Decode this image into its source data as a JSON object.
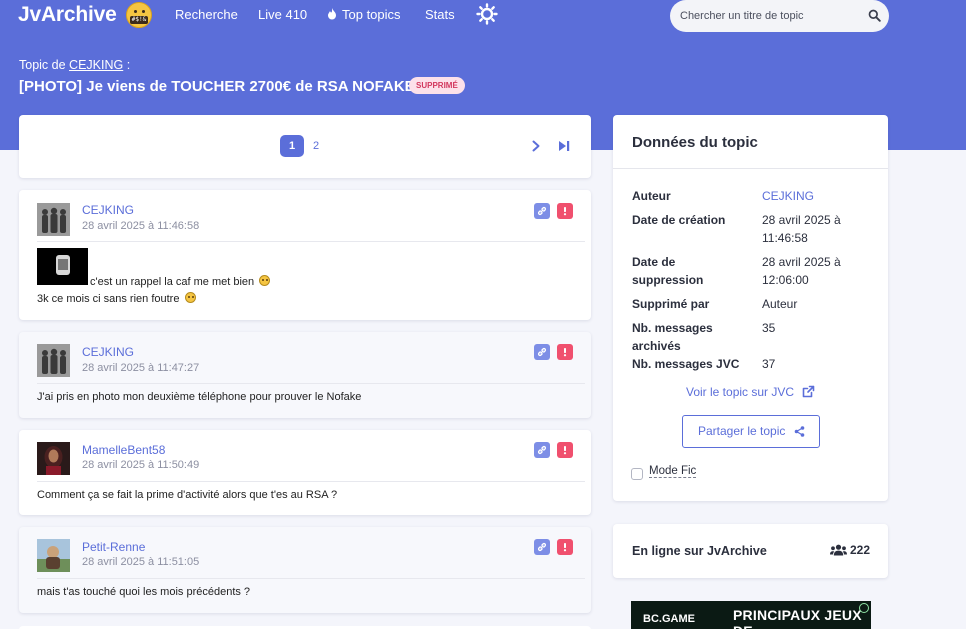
{
  "header": {
    "logo": "JvArchive",
    "logo_emoji_text": "#$!&",
    "nav": [
      "Recherche",
      "Live 410",
      "Top topics",
      "Stats"
    ],
    "search_placeholder": "Chercher un titre de topic"
  },
  "topic": {
    "of_label": "Topic de",
    "author": "CEJKING",
    "author_suffix": ":",
    "title": "[PHOTO] Je viens de TOUCHER 2700€ de RSA NOFAKE",
    "badge": "SUPPRIMÉ"
  },
  "pagination": {
    "pages": [
      "1",
      "2"
    ],
    "current": "1"
  },
  "posts": [
    {
      "author": "CEJKING",
      "date": "28 avril 2025 à 11:46:58",
      "lines": [
        "c'est un rappel la caf me met bien",
        "3k ce mois ci sans rien foutre"
      ]
    },
    {
      "author": "CEJKING",
      "date": "28 avril 2025 à 11:47:27",
      "lines": [
        "J'ai pris en photo mon deuxième téléphone pour prouver le Nofake"
      ]
    },
    {
      "author": "MamelleBent58",
      "date": "28 avril 2025 à 11:50:49",
      "lines": [
        "Comment ça se fait la prime d'activité alors que t'es au RSA ?"
      ]
    },
    {
      "author": "Petit-Renne",
      "date": "28 avril 2025 à 11:51:05",
      "lines": [
        "mais t'as touché quoi les mois précédents ?"
      ]
    }
  ],
  "sidebar": {
    "title": "Données du topic",
    "rows": [
      {
        "key": [
          "Auteur"
        ],
        "value": [
          "CEJKING"
        ]
      },
      {
        "key": [
          "Date de création"
        ],
        "value": [
          "28 avril 2025 à",
          "11:46:58"
        ]
      },
      {
        "key": [
          "Date de",
          "suppression"
        ],
        "value": [
          "28 avril 2025 à",
          "12:06:00"
        ]
      },
      {
        "key": [
          "Supprimé par"
        ],
        "value": [
          "Auteur"
        ]
      },
      {
        "key": [
          "Nb. messages",
          "archivés"
        ],
        "value": [
          "35"
        ]
      },
      {
        "key": [
          "Nb. messages JVC"
        ],
        "value": [
          "37"
        ]
      }
    ],
    "jvc_link": "Voir le topic sur JVC",
    "share_button": "Partager le topic",
    "mode_fic": "Mode Fic"
  },
  "online": {
    "label": "En ligne sur JvArchive",
    "count": "222"
  },
  "ad": {
    "brand": "BC.GAME",
    "text": "PRINCIPAUX JEUX DE"
  },
  "colors": {
    "accent": "#5b6ed9",
    "danger": "#f0506e",
    "badge_bg": "#fce1ea"
  }
}
